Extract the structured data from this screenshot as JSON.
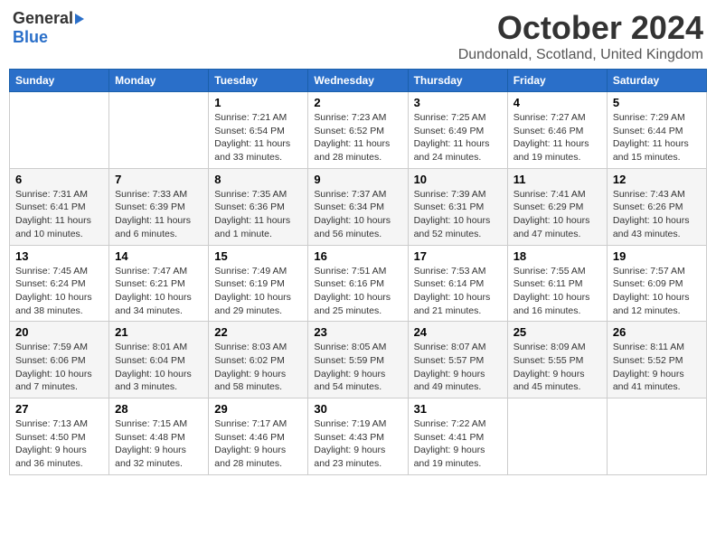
{
  "header": {
    "logo_general": "General",
    "logo_blue": "Blue",
    "month_title": "October 2024",
    "location": "Dundonald, Scotland, United Kingdom"
  },
  "weekdays": [
    "Sunday",
    "Monday",
    "Tuesday",
    "Wednesday",
    "Thursday",
    "Friday",
    "Saturday"
  ],
  "weeks": [
    [
      {
        "day": "",
        "detail": ""
      },
      {
        "day": "",
        "detail": ""
      },
      {
        "day": "1",
        "detail": "Sunrise: 7:21 AM\nSunset: 6:54 PM\nDaylight: 11 hours and 33 minutes."
      },
      {
        "day": "2",
        "detail": "Sunrise: 7:23 AM\nSunset: 6:52 PM\nDaylight: 11 hours and 28 minutes."
      },
      {
        "day": "3",
        "detail": "Sunrise: 7:25 AM\nSunset: 6:49 PM\nDaylight: 11 hours and 24 minutes."
      },
      {
        "day": "4",
        "detail": "Sunrise: 7:27 AM\nSunset: 6:46 PM\nDaylight: 11 hours and 19 minutes."
      },
      {
        "day": "5",
        "detail": "Sunrise: 7:29 AM\nSunset: 6:44 PM\nDaylight: 11 hours and 15 minutes."
      }
    ],
    [
      {
        "day": "6",
        "detail": "Sunrise: 7:31 AM\nSunset: 6:41 PM\nDaylight: 11 hours and 10 minutes."
      },
      {
        "day": "7",
        "detail": "Sunrise: 7:33 AM\nSunset: 6:39 PM\nDaylight: 11 hours and 6 minutes."
      },
      {
        "day": "8",
        "detail": "Sunrise: 7:35 AM\nSunset: 6:36 PM\nDaylight: 11 hours and 1 minute."
      },
      {
        "day": "9",
        "detail": "Sunrise: 7:37 AM\nSunset: 6:34 PM\nDaylight: 10 hours and 56 minutes."
      },
      {
        "day": "10",
        "detail": "Sunrise: 7:39 AM\nSunset: 6:31 PM\nDaylight: 10 hours and 52 minutes."
      },
      {
        "day": "11",
        "detail": "Sunrise: 7:41 AM\nSunset: 6:29 PM\nDaylight: 10 hours and 47 minutes."
      },
      {
        "day": "12",
        "detail": "Sunrise: 7:43 AM\nSunset: 6:26 PM\nDaylight: 10 hours and 43 minutes."
      }
    ],
    [
      {
        "day": "13",
        "detail": "Sunrise: 7:45 AM\nSunset: 6:24 PM\nDaylight: 10 hours and 38 minutes."
      },
      {
        "day": "14",
        "detail": "Sunrise: 7:47 AM\nSunset: 6:21 PM\nDaylight: 10 hours and 34 minutes."
      },
      {
        "day": "15",
        "detail": "Sunrise: 7:49 AM\nSunset: 6:19 PM\nDaylight: 10 hours and 29 minutes."
      },
      {
        "day": "16",
        "detail": "Sunrise: 7:51 AM\nSunset: 6:16 PM\nDaylight: 10 hours and 25 minutes."
      },
      {
        "day": "17",
        "detail": "Sunrise: 7:53 AM\nSunset: 6:14 PM\nDaylight: 10 hours and 21 minutes."
      },
      {
        "day": "18",
        "detail": "Sunrise: 7:55 AM\nSunset: 6:11 PM\nDaylight: 10 hours and 16 minutes."
      },
      {
        "day": "19",
        "detail": "Sunrise: 7:57 AM\nSunset: 6:09 PM\nDaylight: 10 hours and 12 minutes."
      }
    ],
    [
      {
        "day": "20",
        "detail": "Sunrise: 7:59 AM\nSunset: 6:06 PM\nDaylight: 10 hours and 7 minutes."
      },
      {
        "day": "21",
        "detail": "Sunrise: 8:01 AM\nSunset: 6:04 PM\nDaylight: 10 hours and 3 minutes."
      },
      {
        "day": "22",
        "detail": "Sunrise: 8:03 AM\nSunset: 6:02 PM\nDaylight: 9 hours and 58 minutes."
      },
      {
        "day": "23",
        "detail": "Sunrise: 8:05 AM\nSunset: 5:59 PM\nDaylight: 9 hours and 54 minutes."
      },
      {
        "day": "24",
        "detail": "Sunrise: 8:07 AM\nSunset: 5:57 PM\nDaylight: 9 hours and 49 minutes."
      },
      {
        "day": "25",
        "detail": "Sunrise: 8:09 AM\nSunset: 5:55 PM\nDaylight: 9 hours and 45 minutes."
      },
      {
        "day": "26",
        "detail": "Sunrise: 8:11 AM\nSunset: 5:52 PM\nDaylight: 9 hours and 41 minutes."
      }
    ],
    [
      {
        "day": "27",
        "detail": "Sunrise: 7:13 AM\nSunset: 4:50 PM\nDaylight: 9 hours and 36 minutes."
      },
      {
        "day": "28",
        "detail": "Sunrise: 7:15 AM\nSunset: 4:48 PM\nDaylight: 9 hours and 32 minutes."
      },
      {
        "day": "29",
        "detail": "Sunrise: 7:17 AM\nSunset: 4:46 PM\nDaylight: 9 hours and 28 minutes."
      },
      {
        "day": "30",
        "detail": "Sunrise: 7:19 AM\nSunset: 4:43 PM\nDaylight: 9 hours and 23 minutes."
      },
      {
        "day": "31",
        "detail": "Sunrise: 7:22 AM\nSunset: 4:41 PM\nDaylight: 9 hours and 19 minutes."
      },
      {
        "day": "",
        "detail": ""
      },
      {
        "day": "",
        "detail": ""
      }
    ]
  ]
}
